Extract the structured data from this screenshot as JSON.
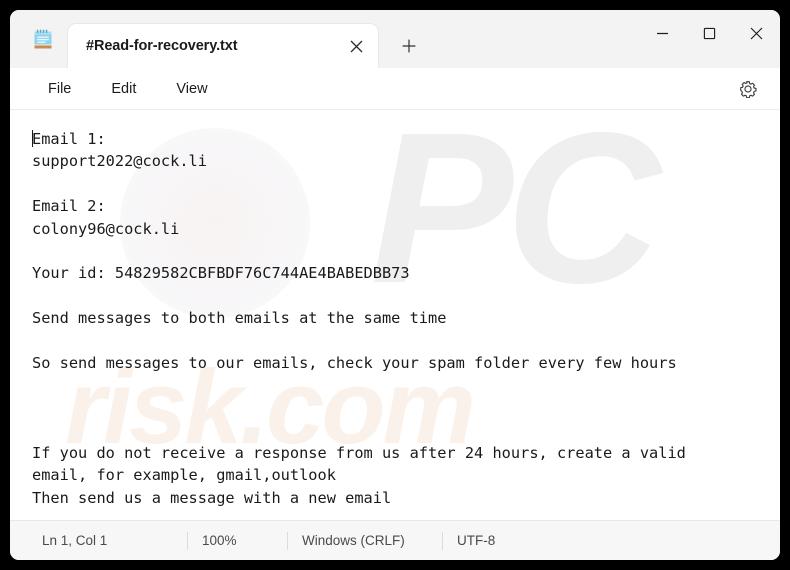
{
  "window": {
    "app_icon": "notepad-icon",
    "controls": {
      "minimize": "minimize-icon",
      "maximize": "maximize-icon",
      "close": "close-icon"
    }
  },
  "tabbar": {
    "tabs": [
      {
        "title": "#Read-for-recovery.txt",
        "close_icon": "close-icon",
        "active": true
      }
    ],
    "new_tab_icon": "plus-icon"
  },
  "menubar": {
    "items": [
      {
        "label": "File"
      },
      {
        "label": "Edit"
      },
      {
        "label": "View"
      }
    ],
    "settings_icon": "gear-icon"
  },
  "editor": {
    "watermark_top": "PC",
    "watermark_bottom": "risk.com",
    "lines": [
      "Email 1:",
      "support2022@cock.li",
      "",
      "Email 2:",
      "colony96@cock.li",
      "",
      "Your id: 54829582CBFBDF76C744AE4BABEDBB73",
      "",
      "Send messages to both emails at the same time",
      "",
      "So send messages to our emails, check your spam folder every few hours",
      "",
      "",
      "",
      "If you do not receive a response from us after 24 hours, create a valid",
      "email, for example, gmail,outlook",
      "Then send us a message with a new email"
    ],
    "text": "Email 1:\nsupport2022@cock.li\n\nEmail 2:\ncolony96@cock.li\n\nYour id: 54829582CBFBDF76C744AE4BABEDBB73\n\nSend messages to both emails at the same time\n\nSo send messages to our emails, check your spam folder every few hours\n\n\n\nIf you do not receive a response from us after 24 hours, create a valid\nemail, for example, gmail,outlook\nThen send us a message with a new email"
  },
  "statusbar": {
    "position": "Ln 1, Col 1",
    "zoom": "100%",
    "line_endings": "Windows (CRLF)",
    "encoding": "UTF-8"
  },
  "colors": {
    "desktop": "#000000",
    "chrome": "#f3f3f3",
    "page": "#ffffff",
    "text": "#1a1a1a",
    "status_text": "#4a4a4a"
  }
}
